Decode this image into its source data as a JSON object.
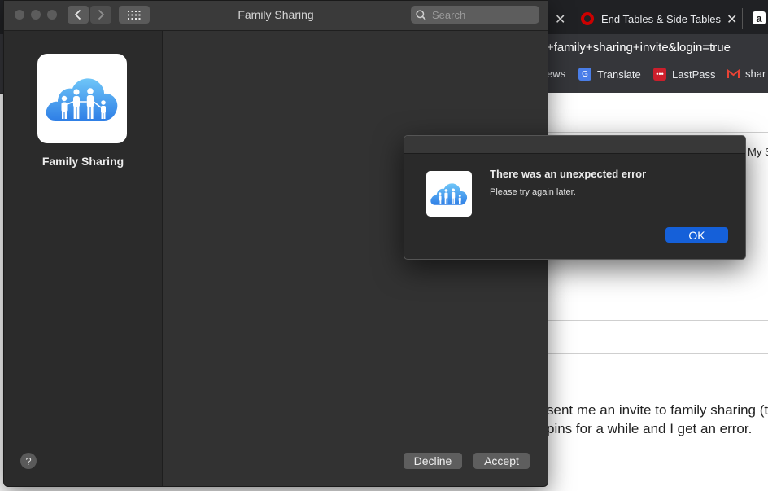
{
  "browser": {
    "tabs": [
      {
        "label": "End Tables & Side Tables",
        "icon": "target-icon",
        "color": "#cc0000"
      }
    ],
    "url_fragment": "+family+sharing+invite&login=true",
    "bookmarks": [
      {
        "label": "ews"
      },
      {
        "label": "Translate",
        "icon": "google-translate-icon"
      },
      {
        "label": "LastPass",
        "icon": "lastpass-icon"
      },
      {
        "label": "shar",
        "icon": "gmail-icon"
      }
    ],
    "page_text": {
      "side_label": "My S",
      "line1": "sent me an invite to family sharing (th",
      "line2": "pins for a while and I get an error."
    }
  },
  "window": {
    "title": "Family Sharing",
    "search_placeholder": "Search",
    "sidebar_title": "Family Sharing",
    "help_label": "?",
    "decline_label": "Decline",
    "accept_label": "Accept"
  },
  "alert": {
    "title": "There was an unexpected error",
    "message": "Please try again later.",
    "ok_label": "OK"
  },
  "colors": {
    "accent": "#1560d9",
    "window_bg": "#323232",
    "sidebar_bg": "#2b2b2b"
  }
}
